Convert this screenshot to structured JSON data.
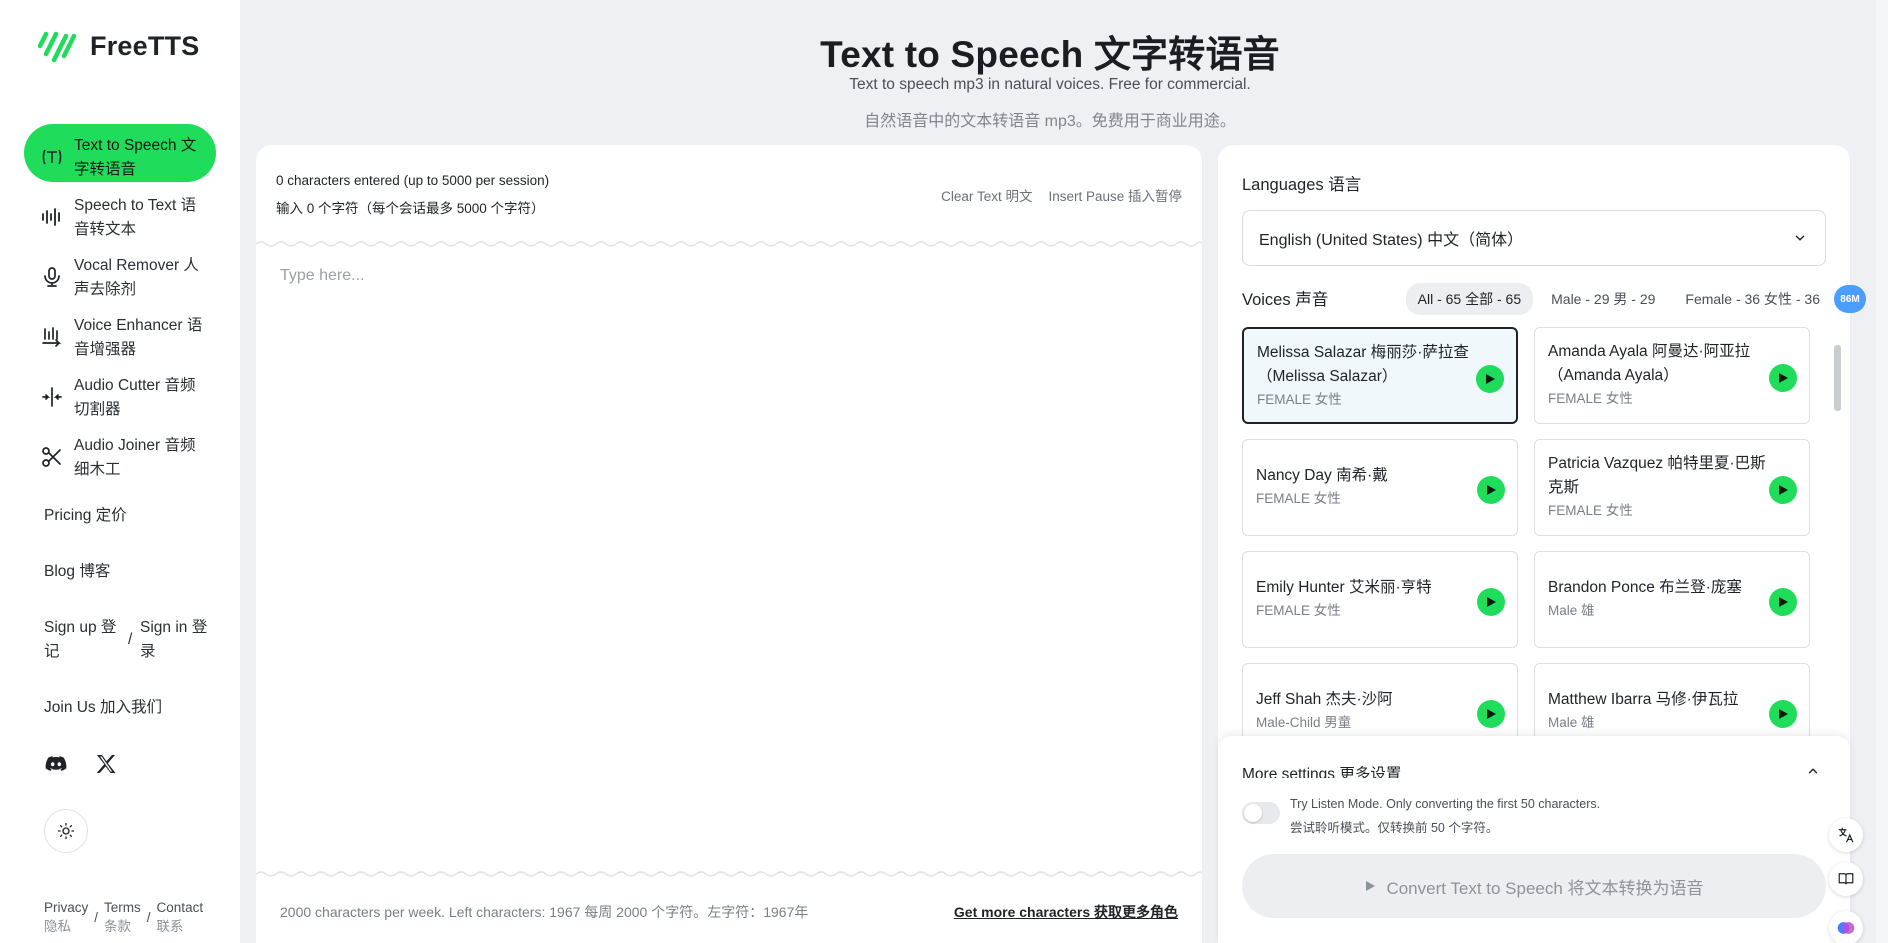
{
  "brand": {
    "name": "FreeTTS",
    "accent": "#1fdc5a"
  },
  "header": {
    "title": "Text to Speech  文字转语音",
    "subtitle_en": "Text to speech mp3 in natural voices. Free for commercial.",
    "subtitle_zh": "自然语音中的文本转语音 mp3。免费用于商业用途。"
  },
  "sidebar": {
    "items": [
      {
        "label": "Text to Speech 文字转语音",
        "icon": "text-speech-icon",
        "active": true
      },
      {
        "label": "Speech to Text 语音转文本",
        "icon": "waveform-icon",
        "active": false
      },
      {
        "label": "Vocal Remover 人声去除剂",
        "icon": "microphone-icon",
        "active": false
      },
      {
        "label": "Voice Enhancer 语音增强器",
        "icon": "enhancer-icon",
        "active": false
      },
      {
        "label": "Audio Cutter 音频切割器",
        "icon": "cutter-icon",
        "active": false
      },
      {
        "label": "Audio Joiner 音频细木工",
        "icon": "scissors-icon",
        "active": false
      }
    ],
    "pricing": "Pricing 定价",
    "blog": "Blog 博客",
    "signup": "Sign up 登记",
    "slash": "/",
    "signin": "Sign in 登录",
    "join": "Join Us 加入我们",
    "footer": {
      "privacy_en": "Privacy",
      "privacy_zh": "隐私",
      "terms_en": "Terms",
      "terms_zh": "条款",
      "contact_en": "Contact",
      "contact_zh": "联系"
    }
  },
  "editor": {
    "count_en": "0 characters entered (up to 5000 per session)",
    "count_zh": "输入 0 个字符（每个会话最多 5000 个字符）",
    "clear": "Clear Text 明文",
    "pause": "Insert Pause 插入暂停",
    "placeholder": "Type here...",
    "footer_left": "2000 characters per week. Left characters: 1967 每周 2000 个字符。左字符：1967年",
    "footer_right": "Get more characters 获取更多角色"
  },
  "languages": {
    "label": "Languages 语言",
    "selected": "English (United States) 中文（简体）"
  },
  "voices": {
    "label": "Voices 声音",
    "filters": [
      "All - 65 全部 - 65",
      "Male - 29 男 - 29",
      "Female - 36 女性 - 36"
    ],
    "items": [
      {
        "name": "Melissa Salazar 梅丽莎·萨拉查（Melissa Salazar）",
        "gender": "FEMALE 女性",
        "selected": true
      },
      {
        "name": "Amanda Ayala 阿曼达·阿亚拉（Amanda Ayala）",
        "gender": "FEMALE 女性",
        "selected": false
      },
      {
        "name": "Nancy Day 南希·戴",
        "gender": "FEMALE 女性",
        "selected": false
      },
      {
        "name": "Patricia Vazquez 帕特里夏·巴斯克斯",
        "gender": "FEMALE 女性",
        "selected": false
      },
      {
        "name": "Emily Hunter 艾米丽·亨特",
        "gender": "FEMALE 女性",
        "selected": false
      },
      {
        "name": "Brandon Ponce 布兰登·庞塞",
        "gender": "Male 雄",
        "selected": false
      },
      {
        "name": "Jeff Shah 杰夫·沙阿",
        "gender": "Male-Child 男童",
        "selected": false
      },
      {
        "name": "Matthew Ibarra 马修·伊瓦拉",
        "gender": "Male 雄",
        "selected": false
      }
    ]
  },
  "settings": {
    "title": "More settings 更多设置",
    "listen_en": "Try Listen Mode. Only converting the first 50 characters.",
    "listen_zh": "尝试聆听模式。仅转换前 50 个字符。",
    "convert": "Convert Text to Speech 将文本转换为语音"
  },
  "tools": {
    "badge": "86M"
  }
}
